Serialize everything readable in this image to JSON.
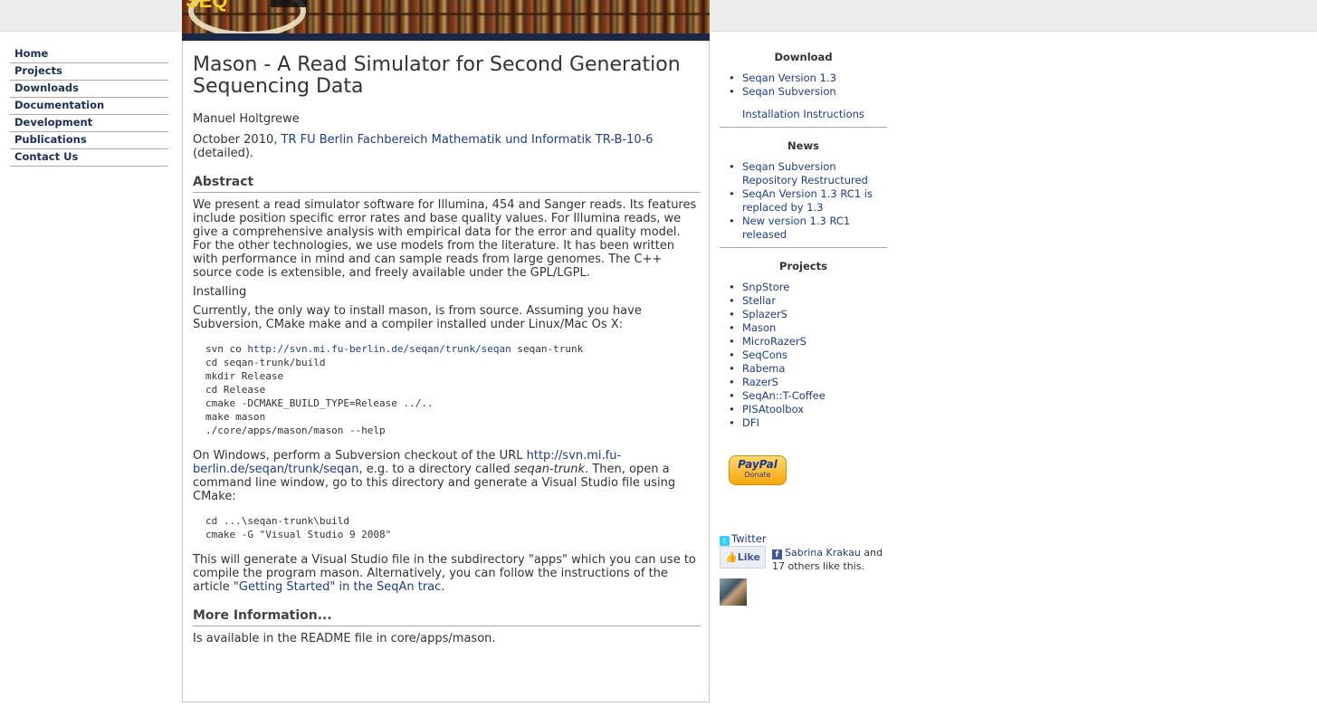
{
  "nav": {
    "items": [
      "Home",
      "Projects",
      "Downloads",
      "Documentation",
      "Development",
      "Publications",
      "Contact Us"
    ]
  },
  "banner": {
    "logo_text": "SEQ"
  },
  "article": {
    "title": "Mason - A Read Simulator for Second Generation Sequencing Data",
    "author": "Manuel Holtgrewe",
    "citation_prefix": "October 2010, ",
    "citation_link": "TR FU Berlin Fachbereich Mathematik und Informatik TR-B-10-6",
    "citation_suffix": " (detailed).",
    "abstract_heading": "Abstract",
    "abstract_text": "We present a read simulator software for Illumina, 454 and Sanger reads. Its features include position specific error rates and base quality values. For Illumina reads, we give a comprehensive analysis with empirical data for the error and quality model. For the other technologies, we use models from the literature. It has been written with performance in mind and can sample reads from large genomes. The C++ source code is extensible, and freely available under the GPL/LGPL.",
    "installing_label": "Installing",
    "install_intro": "Currently, the only way to install mason, is from source. Assuming you have Subversion, CMake make and a compiler installed under Linux/Mac Os X:",
    "code_unix": {
      "line1_prefix": "svn co ",
      "line1_link": "http://svn.mi.fu-berlin.de/seqan/trunk/seqan",
      "line1_suffix": " seqan-trunk",
      "lines": [
        "cd seqan-trunk/build",
        "mkdir Release",
        "cd Release",
        "cmake -DCMAKE_BUILD_TYPE=Release ../..",
        "make mason",
        "./core/apps/mason/mason --help"
      ]
    },
    "windows_prefix": "On Windows, perform a Subversion checkout of the URL ",
    "windows_link": "http://svn.mi.fu-berlin.de/seqan/trunk/seqan",
    "windows_middle": ", e.g. to a directory called ",
    "windows_dir": "seqan-trunk",
    "windows_suffix": ". Then, open a command line window, go to this directory and generate a Visual Studio file using CMake:",
    "code_windows": [
      "cd ...\\seqan-trunk\\build",
      "cmake -G \"Visual Studio 9 2008\""
    ],
    "vs_prefix": "This will generate a Visual Studio file in the subdirectory \"apps\" which you can use to compile the program mason. Alternatively, you can follow the instructions of the article ",
    "vs_link": "\"Getting Started\" in the SeqAn trac",
    "vs_suffix": ".",
    "more_heading": "More Information...",
    "more_text": "Is available in the README file in core/apps/mason."
  },
  "sidebar": {
    "download_heading": "Download",
    "download_items": [
      "Seqan Version 1.3",
      "Seqan Subversion"
    ],
    "install_link": "Installation Instructions",
    "news_heading": "News",
    "news_items": [
      "Seqan Subversion Repository Restructured",
      "SeqAn Version 1.3 RC1 is replaced by 1.3",
      "New version 1.3 RC1 released"
    ],
    "projects_heading": "Projects",
    "projects_items": [
      "SnpStore",
      "Stellar",
      "SplazerS",
      "Mason",
      "MicroRazerS",
      "SeqCons",
      "Rabema",
      "RazerS",
      "SeqAn::T-Coffee",
      "PISAtoolbox",
      "DFI"
    ],
    "paypal_logo": "PayPal",
    "paypal_donate": "Donate",
    "twitter_label": "Twitter",
    "like_label": "Like",
    "fb_name": "Sabrina Krakau",
    "fb_and": " and",
    "fb_rest": "17 others like this."
  }
}
